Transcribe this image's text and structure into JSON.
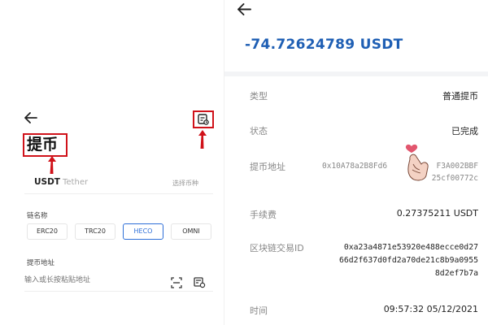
{
  "left": {
    "title": "提币",
    "coin": {
      "symbol": "USDT",
      "name": "Tether",
      "select_label": "选择币种"
    },
    "chain_label": "链名称",
    "chains": [
      "ERC20",
      "TRC20",
      "HECO",
      "OMNI"
    ],
    "selected_chain": "HECO",
    "address_label": "提币地址",
    "address_placeholder": "输入或长按粘贴地址"
  },
  "right": {
    "amount": "-74.72624789 USDT",
    "rows": {
      "type": {
        "label": "类型",
        "value": "普通提币"
      },
      "status": {
        "label": "状态",
        "value": "已完成"
      },
      "address": {
        "label": "提币地址",
        "line1": "0x10A78a2B8Fd6",
        "line1b": "F3A002BBF",
        "line2": "25cf00772c"
      },
      "fee": {
        "label": "手续费",
        "value": "0.27375211 USDT"
      },
      "txid": {
        "label": "区块链交易ID",
        "line1": "0xa23a4871e53920e488ecce0d27",
        "line2": "66d2f637d0fd2a70de21c8b9a0955",
        "line3": "8d2ef7b7a"
      },
      "time": {
        "label": "时间",
        "value": "09:57:32 05/12/2021"
      }
    }
  },
  "colors": {
    "accent_blue": "#1f5fb4",
    "annotation_red": "#d0121a",
    "heart_pink": "#e2566e"
  }
}
